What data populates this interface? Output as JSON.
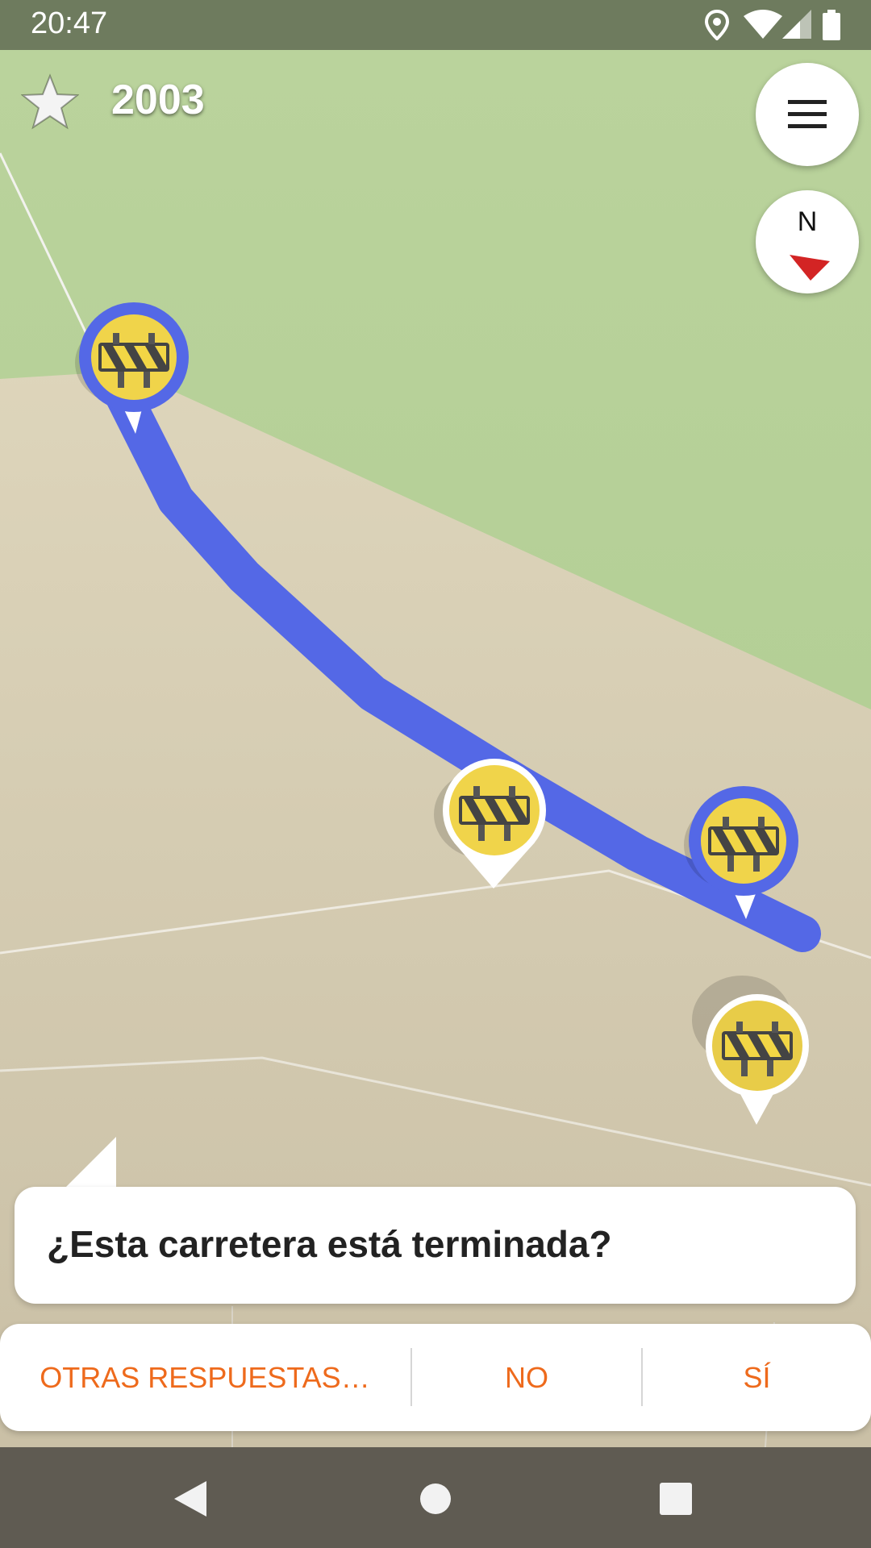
{
  "status_bar": {
    "time": "20:47"
  },
  "map": {
    "title": "2003",
    "route_color": "#5468e6"
  },
  "compass": {
    "label": "N"
  },
  "quest": {
    "question": "¿Esta carretera está terminada?"
  },
  "answers": {
    "other": "OTRAS RESPUESTAS…",
    "no": "NO",
    "yes": "SÍ"
  },
  "colors": {
    "accent": "#ee6a1c",
    "pin_yellow": "#f0d44a",
    "status_bar": "#6e7b5e"
  },
  "icons": [
    "location-icon",
    "wifi-icon",
    "signal-icon",
    "battery-icon",
    "star-icon",
    "menu-icon",
    "compass-arrow-icon",
    "construction-barrier-icon",
    "back-icon",
    "home-icon",
    "recents-icon"
  ]
}
